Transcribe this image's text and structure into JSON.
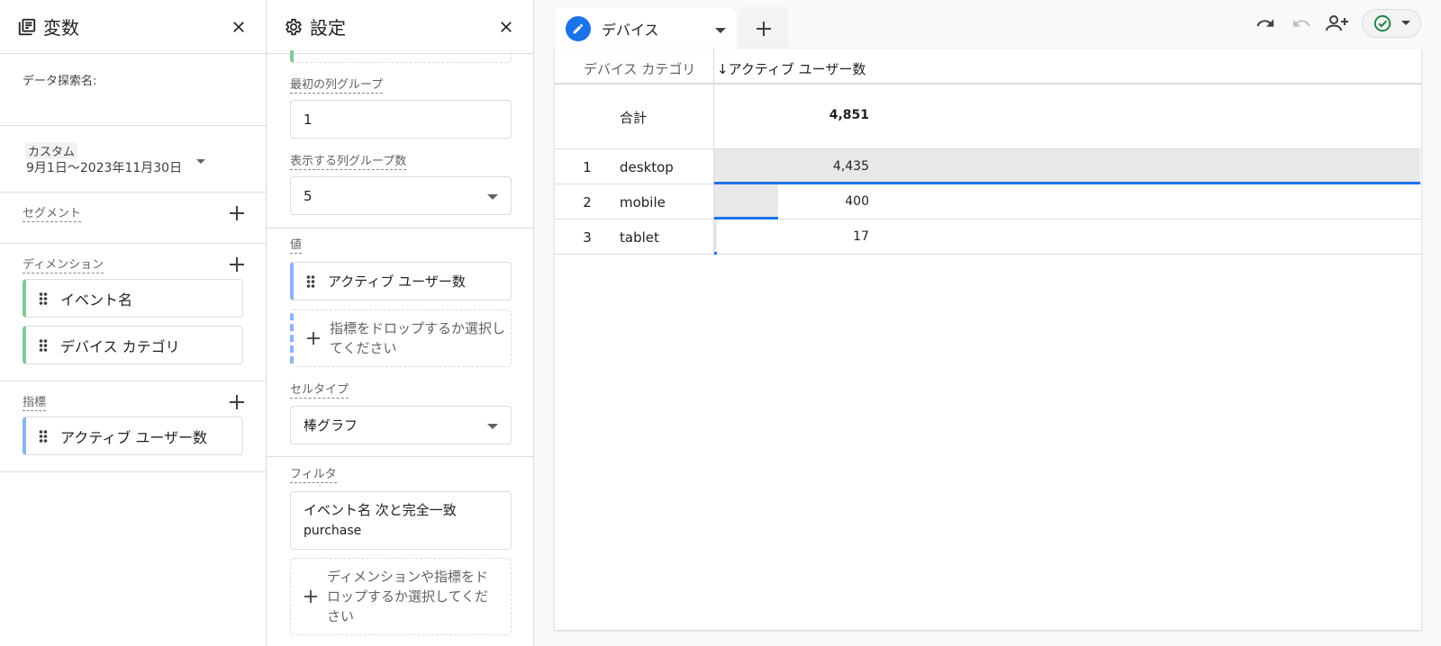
{
  "variables_panel": {
    "title": "変数",
    "exploration_name_label": "データ探索名:",
    "date_range": {
      "tag": "カスタム",
      "value": "9月1日～2023年11月30日"
    },
    "segments_label": "セグメント",
    "dimensions_label": "ディメンション",
    "dimensions": [
      "イベント名",
      "デバイス カテゴリ"
    ],
    "metrics_label": "指標",
    "metrics": [
      "アクティブ ユーザー数"
    ]
  },
  "settings_panel": {
    "title": "設定",
    "first_column_group_label": "最初の列グループ",
    "first_column_group_value": "1",
    "shown_column_groups_label": "表示する列グループ数",
    "shown_column_groups_value": "5",
    "values_label": "値",
    "values_chip": "アクティブ ユーザー数",
    "values_drop_hint": "指標をドロップするか選択してください",
    "cell_type_label": "セルタイプ",
    "cell_type_value": "棒グラフ",
    "filter_label": "フィルタ",
    "filter_line1": "イベント名 次と完全一致",
    "filter_line2": "purchase",
    "filter_drop_hint": "ディメンションや指標をドロップするか選択してください"
  },
  "tab": {
    "label": "デバイス"
  },
  "table": {
    "dim_header": "デバイス カテゴリ",
    "metric_header": "↓アクティブ ユーザー数",
    "total_label": "合計",
    "total_value": "4,851",
    "rows": [
      {
        "index": "1",
        "category": "desktop",
        "value": "4,435",
        "share": 1.0
      },
      {
        "index": "2",
        "category": "mobile",
        "value": "400",
        "share": 0.09
      },
      {
        "index": "3",
        "category": "tablet",
        "value": "17",
        "share": 0.004
      }
    ]
  },
  "colors": {
    "accent": "#1a73e8",
    "dimension_chip": "#81c995",
    "metric_chip": "#8ab4f8",
    "status_green": "#188038"
  },
  "icons": [
    "variables-icon",
    "settings-gear-icon",
    "close-icon",
    "plus-icon",
    "drag-handle-icon",
    "edit-pencil-icon",
    "dropdown-caret-icon",
    "undo-icon",
    "redo-icon",
    "share-user-icon",
    "check-circle-icon"
  ]
}
